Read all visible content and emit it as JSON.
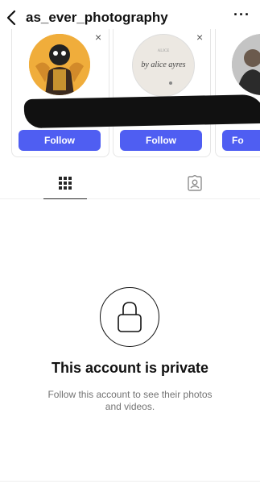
{
  "header": {
    "username": "as_ever_photography",
    "more_label": "···"
  },
  "suggestions": [
    {
      "close_label": "×",
      "follow_label": "Follow"
    },
    {
      "close_label": "×",
      "avatar_text": "by alice ayres",
      "avatar_small": "ALICE",
      "follow_label": "Follow"
    },
    {
      "follow_label": "Fo"
    }
  ],
  "tabs": {
    "grid_icon": "grid-icon",
    "tagged_icon": "tagged-person-icon"
  },
  "private": {
    "icon": "lock-icon",
    "title": "This account is private",
    "subtitle": "Follow this account to see their photos and videos."
  },
  "colors": {
    "follow_button": "#4f5ef2",
    "text_primary": "#111111",
    "text_secondary": "#737373"
  }
}
